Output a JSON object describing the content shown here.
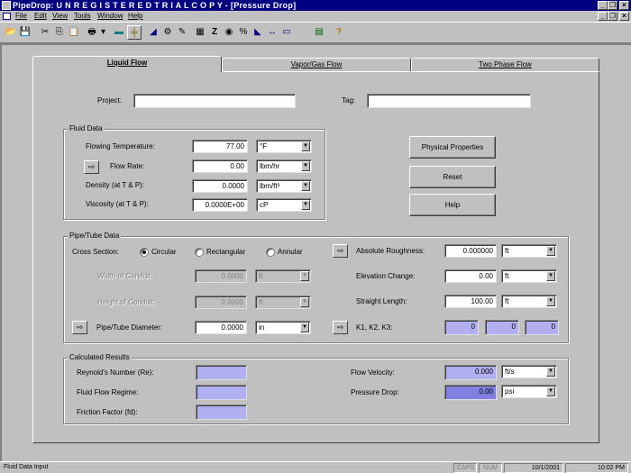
{
  "window": {
    "title": "PipeDrop:  U N R E G I S T E R E D   T R I A L   C O P Y - [Pressure Drop]",
    "minimize": "_",
    "restore": "❐",
    "close": "×"
  },
  "menu": {
    "items": [
      "File",
      "Edit",
      "View",
      "Tools",
      "Window",
      "Help"
    ],
    "mdi_minimize": "_",
    "mdi_restore": "❐",
    "mdi_close": "×"
  },
  "toolbar": {
    "icons": [
      "open-folder-icon",
      "save-icon",
      "cut-icon",
      "copy-icon",
      "paste-icon",
      "print-icon",
      "dropdown-icon",
      "pipe-icon",
      "tee-icon",
      "valve-icon",
      "fitting-icon",
      "tool-icon",
      "grid-icon",
      "z-icon",
      "gear-icon",
      "percent-icon",
      "flag-icon",
      "arrows-icon",
      "ruler-icon",
      "report-icon",
      "help-icon"
    ],
    "glyphs": [
      "📂",
      "💾",
      "✂",
      "⎘",
      "📋",
      "🖶",
      "▾",
      "▬",
      "╪",
      "◢",
      "⚙",
      "✎",
      "▦",
      "Z",
      "◉",
      "%",
      "◣",
      "↔",
      "▭",
      "▤",
      "?"
    ]
  },
  "tabs": {
    "liquid": "Liquid Flow",
    "vapor": "Vapor/Gas Flow",
    "two_phase": "Two Phase Flow"
  },
  "project": {
    "label": "Project:",
    "value": ""
  },
  "tag": {
    "label": "Tag:",
    "value": ""
  },
  "fluid": {
    "title": "Fluid Data",
    "temp_label": "Flowing Temperature:",
    "temp_value": "77.00",
    "temp_unit": "°F",
    "flow_label": "Flow Rate:",
    "flow_value": "0.00",
    "flow_unit": "lbm/hr",
    "density_label": "Density (at T & P):",
    "density_value": "0.0000",
    "density_unit": "lbm/ft³",
    "visc_label": "Viscosity (at T & P):",
    "visc_value": "0.0000E+00",
    "visc_unit": "cP",
    "arrow": "⇨"
  },
  "buttons": {
    "physical": "Physical Properties",
    "reset": "Reset",
    "help": "Help"
  },
  "pipe": {
    "title": "Pipe/Tube Data",
    "cross_label": "Cross Section:",
    "circular": "Circular",
    "rectangular": "Rectangular",
    "annular": "Annular",
    "width_label": "Width of Conduit:",
    "width_value": "0.0000",
    "width_unit": "ft",
    "height_label": "Height of Conduit:",
    "height_value": "0.0000",
    "height_unit": "ft",
    "diam_label": "Pipe/Tube Diameter:",
    "diam_value": "0.0000",
    "diam_unit": "in",
    "rough_label": "Absolute Roughness:",
    "rough_value": "0.000000",
    "rough_unit": "ft",
    "elev_label": "Elevation Change:",
    "elev_value": "0.00",
    "elev_unit": "ft",
    "straight_label": "Straight Length:",
    "straight_value": "100.00",
    "straight_unit": "ft",
    "k_label": "K1, K2, K3:",
    "k1": "0",
    "k2": "0",
    "k3": "0",
    "arrow": "⇨"
  },
  "results": {
    "title": "Calculated Results",
    "reynolds_label": "Reynold's Number (Re):",
    "regime_label": "Fluid Flow Regime:",
    "friction_label": "Friction Factor (fd):",
    "velocity_label": "Flow Velocity:",
    "velocity_value": "0.000",
    "velocity_unit": "ft/s",
    "pdrop_label": "Pressure Drop:",
    "pdrop_value": "0.00",
    "pdrop_unit": "psi"
  },
  "status": {
    "message": "Fluid Data Input",
    "caps": "CAPS",
    "num": "NUM",
    "date": "10/1/2001",
    "time": "10:02 PM"
  }
}
